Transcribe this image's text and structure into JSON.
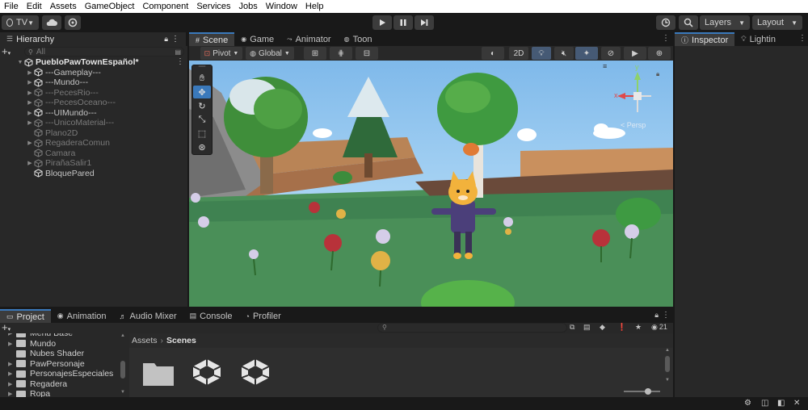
{
  "menu": [
    "File",
    "Edit",
    "Assets",
    "GameObject",
    "Component",
    "Services",
    "Jobs",
    "Window",
    "Help"
  ],
  "toolbar": {
    "account_label": "TV",
    "layers_label": "Layers",
    "layout_label": "Layout"
  },
  "hierarchy": {
    "tab_label": "Hierarchy",
    "search_placeholder": "All",
    "scene_name": "PuebloPawTownEspañol*",
    "items": [
      {
        "label": "---Gameplay---",
        "dim": false,
        "expandable": true
      },
      {
        "label": "---Mundo---",
        "dim": false,
        "expandable": true
      },
      {
        "label": "---PecesRio---",
        "dim": true,
        "expandable": true
      },
      {
        "label": "---PecesOceano---",
        "dim": true,
        "expandable": true
      },
      {
        "label": "---UIMundo---",
        "dim": false,
        "expandable": true
      },
      {
        "label": "---UnicoMaterial---",
        "dim": true,
        "expandable": true
      },
      {
        "label": "Plano2D",
        "dim": true,
        "expandable": false
      },
      {
        "label": "RegaderaComun",
        "dim": true,
        "expandable": true
      },
      {
        "label": "Camara",
        "dim": true,
        "expandable": false
      },
      {
        "label": "PirañaSalir1",
        "dim": true,
        "expandable": true
      },
      {
        "label": "BloquePared",
        "dim": false,
        "expandable": false
      }
    ]
  },
  "center_tabs": [
    {
      "label": "Scene",
      "icon": "grid-icon"
    },
    {
      "label": "Game",
      "icon": "gamepad-icon"
    },
    {
      "label": "Animator",
      "icon": "animator-icon"
    },
    {
      "label": "Toon",
      "icon": "toon-icon"
    }
  ],
  "scene_toolbar": {
    "pivot_label": "Pivot",
    "global_label": "Global",
    "mode_2d_label": "2D",
    "persp_label": "< Persp"
  },
  "gizmo_axes": {
    "x": "x",
    "y": "y"
  },
  "right_tabs": [
    {
      "label": "Inspector",
      "icon": "info-icon"
    },
    {
      "label": "Lightin",
      "icon": "light-icon"
    }
  ],
  "bottom_tabs": [
    {
      "label": "Project",
      "icon": "folder-icon"
    },
    {
      "label": "Animation",
      "icon": "animation-icon"
    },
    {
      "label": "Audio Mixer",
      "icon": "audio-icon"
    },
    {
      "label": "Console",
      "icon": "console-icon"
    },
    {
      "label": "Profiler",
      "icon": "profiler-icon"
    }
  ],
  "project": {
    "folders": [
      "Menu Base",
      "Mundo",
      "Nubes Shader",
      "PawPersonaje",
      "PersonajesEspeciales",
      "Regadera",
      "Ropa"
    ],
    "breadcrumb": [
      "Assets",
      "Scenes"
    ],
    "hidden_count": "21"
  },
  "colors": {
    "accent": "#3a79bb",
    "panel": "#282828",
    "background": "#191919",
    "sky": "#8fc4ee",
    "grass": "#4a8f58"
  }
}
